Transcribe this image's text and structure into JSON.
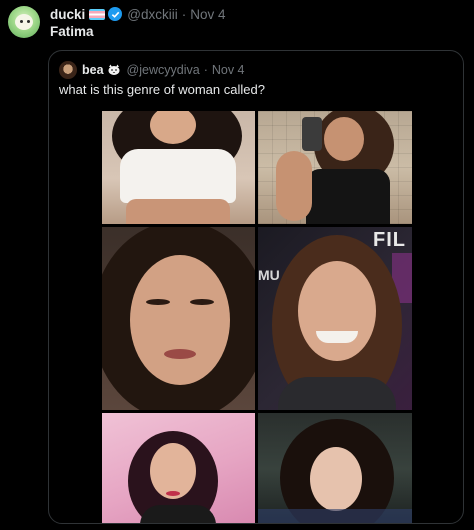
{
  "post": {
    "author_name": "ducki",
    "author_handle": "@dxckiii",
    "separator": "·",
    "date": "Nov 4",
    "text": "Fatima",
    "flag_icon": "trans-flag-icon",
    "verified_icon": "verified-badge-icon"
  },
  "quote": {
    "author_name": "bea",
    "author_emoji": "cat-emoji-icon",
    "author_handle": "@jewcyydiva",
    "separator": "·",
    "date": "Nov 4",
    "text": "what is this genre of woman called?",
    "photos": [
      {
        "name": "photo-woman-white-crop-top"
      },
      {
        "name": "photo-woman-mirror-selfie"
      },
      {
        "name": "photo-woman-closeup-curly-hair"
      },
      {
        "name": "photo-woman-smiling-event"
      },
      {
        "name": "photo-woman-pink-background"
      },
      {
        "name": "photo-woman-dark-curly-hair"
      }
    ],
    "photo4_banner": "FIL",
    "photo4_side_text": "MU"
  },
  "colors": {
    "background": "#000000",
    "text_primary": "#e7e9ea",
    "text_muted": "#71767b",
    "verified_blue": "#1d9bf0",
    "border": "#2f3336"
  }
}
